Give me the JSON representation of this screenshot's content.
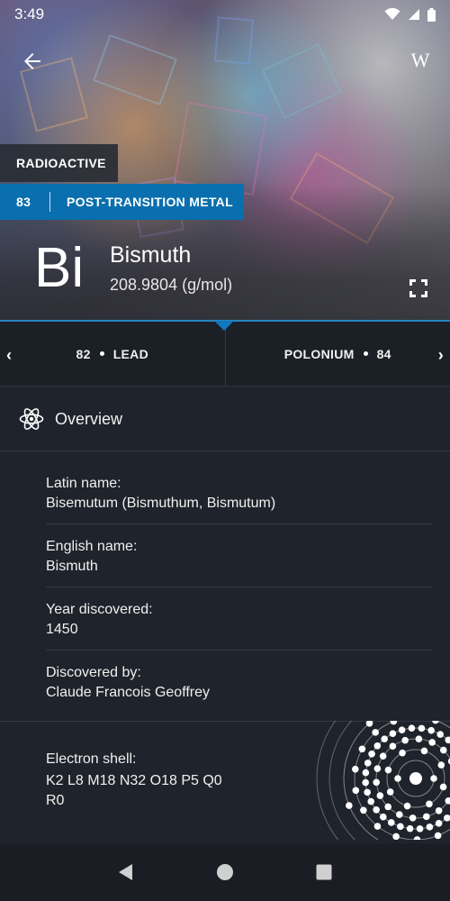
{
  "status": {
    "time": "3:49"
  },
  "hero": {
    "tags": {
      "primary": "RADIOACTIVE",
      "atomic_number": "83",
      "group": "POST-TRANSITION METAL"
    },
    "symbol": "Bi",
    "name": "Bismuth",
    "mass": "208.9804 (g/mol)",
    "wiki_label": "W"
  },
  "nav": {
    "prev": {
      "number": "82",
      "name": "LEAD"
    },
    "next": {
      "name": "POLONIUM",
      "number": "84"
    }
  },
  "overview": {
    "title": "Overview",
    "items": [
      {
        "label": "Latin name:",
        "value": "Bisemutum (Bismuthum, Bismutum)"
      },
      {
        "label": "English name:",
        "value": "Bismuth"
      },
      {
        "label": "Year discovered:",
        "value": "1450"
      },
      {
        "label": "Discovered by:",
        "value": "Claude Francois Geoffrey"
      }
    ],
    "shell": {
      "label": "Electron shell:",
      "value": "K2 L8 M18 N32 O18 P5 Q0 R0"
    }
  },
  "colors": {
    "accent": "#0a6fae",
    "background": "#1f232b"
  },
  "icons": {
    "back": "arrow-left-icon",
    "wiki": "wikipedia-icon",
    "fullscreen": "fullscreen-icon",
    "prev": "chevron-left-icon",
    "next": "chevron-right-icon",
    "overview": "atom-icon",
    "shell": "electron-shell-icon"
  }
}
